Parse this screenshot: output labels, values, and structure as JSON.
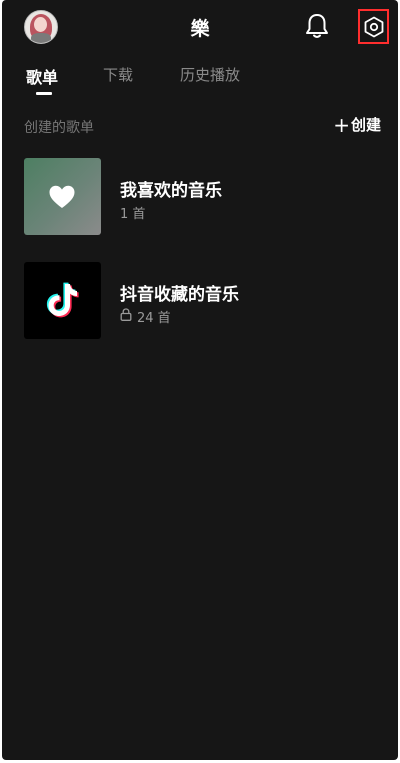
{
  "header": {
    "title": "樂",
    "avatar_icon": "user-avatar",
    "notifications_icon": "bell-icon",
    "settings_icon": "settings-hexagon-icon",
    "settings_highlight_color": "#ff2e2e"
  },
  "tabs": [
    {
      "label": "歌单",
      "active": true
    },
    {
      "label": "下载",
      "active": false
    },
    {
      "label": "历史播放",
      "active": false
    }
  ],
  "section": {
    "title": "创建的歌单",
    "create_label": "创建"
  },
  "playlists": [
    {
      "name": "我喜欢的音乐",
      "count": "1 首",
      "cover_icon": "heart-icon",
      "locked": false
    },
    {
      "name": "抖音收藏的音乐",
      "count": "24 首",
      "cover_icon": "tiktok-logo-icon",
      "locked": true
    }
  ],
  "colors": {
    "background": "#161616",
    "text_primary": "#ffffff",
    "text_secondary": "#9a9a9a"
  }
}
